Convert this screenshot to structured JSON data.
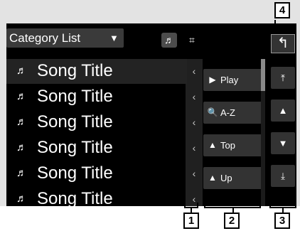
{
  "header": {
    "category_label": "Category List",
    "category_arrow": "▼",
    "music_icon": "♬",
    "video_icon": "⌗",
    "back_icon": "↰"
  },
  "song_list": {
    "note_icon": "♬",
    "items": [
      {
        "title": "Song Title",
        "selected": true
      },
      {
        "title": "Song Title",
        "selected": false
      },
      {
        "title": "Song Title",
        "selected": false
      },
      {
        "title": "Song Title",
        "selected": false
      },
      {
        "title": "Song Title",
        "selected": false
      },
      {
        "title": "Song Title",
        "selected": false
      }
    ],
    "expand_chevron": "‹"
  },
  "search_buttons": [
    {
      "icon": "▶",
      "label": "Play"
    },
    {
      "icon": "🔍",
      "label": "A-Z"
    },
    {
      "icon": "▲",
      "label": "Top"
    },
    {
      "icon": "▲",
      "label": "Up"
    }
  ],
  "page_buttons": [
    {
      "icon": "⤒",
      "name": "first"
    },
    {
      "icon": "▲",
      "name": "previous"
    },
    {
      "icon": "▼",
      "name": "next"
    },
    {
      "icon": "⤓",
      "name": "last"
    }
  ],
  "callouts": [
    "1",
    "2",
    "3",
    "4"
  ]
}
